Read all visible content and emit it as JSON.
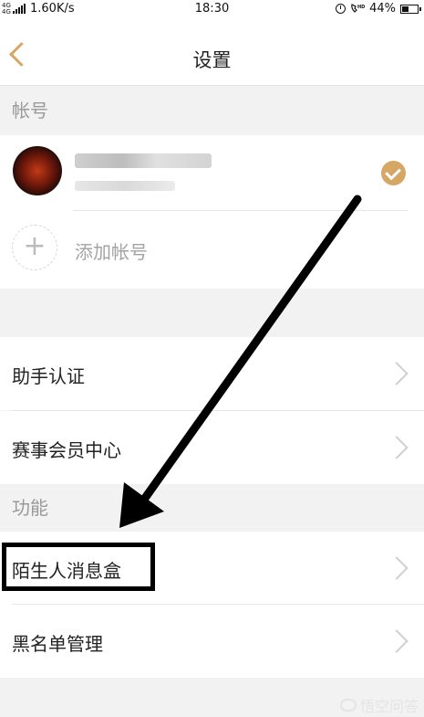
{
  "status_bar": {
    "network_type": "4G 4G",
    "speed": "1.60K/s",
    "time": "18:30",
    "battery": "44%",
    "battery_level": 0.44
  },
  "nav": {
    "title": "设置"
  },
  "sections": {
    "account": "帐号",
    "functions": "功能"
  },
  "account": {
    "add_label": "添加帐号",
    "add_glyph": "+"
  },
  "rows": {
    "assistant_verify": "助手认证",
    "event_member": "赛事会员中心",
    "stranger_box": "陌生人消息盒",
    "blacklist": "黑名单管理"
  },
  "watermark": {
    "text": "悟空问答"
  },
  "colors": {
    "accent": "#d6a664",
    "background": "#f2f2f2"
  }
}
